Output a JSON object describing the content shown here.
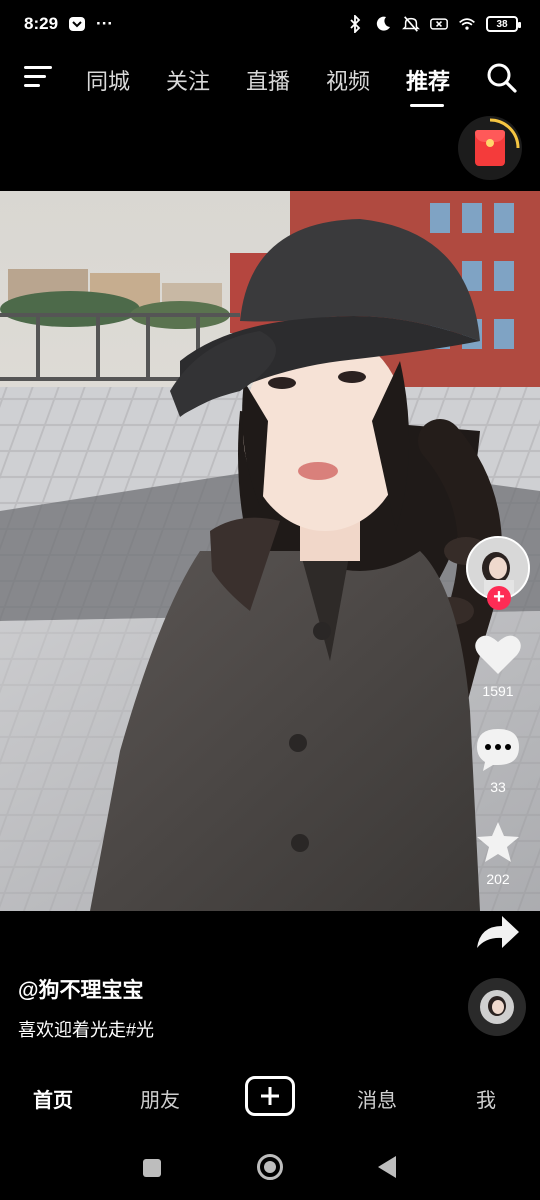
{
  "status_bar": {
    "time": "8:29",
    "more": "···",
    "battery": "38"
  },
  "top_nav": {
    "tabs": [
      {
        "label": "同城"
      },
      {
        "label": "关注"
      },
      {
        "label": "直播"
      },
      {
        "label": "视频"
      },
      {
        "label": "推荐"
      }
    ],
    "active_tab": "推荐"
  },
  "actions": {
    "likes": "1591",
    "comments": "33",
    "favorites": "202"
  },
  "post": {
    "author": "@狗不理宝宝",
    "description": "喜欢迎着光走#光"
  },
  "bottom_nav": {
    "home": "首页",
    "friends": "朋友",
    "messages": "消息",
    "me": "我"
  },
  "icons": {
    "menu": "menu-icon",
    "search": "search-icon",
    "heart": "heart-icon",
    "comment": "comment-icon",
    "star": "star-icon",
    "share": "share-icon",
    "plus": "plus-icon"
  },
  "colors": {
    "accent": "#fe2c55",
    "background": "#000000"
  }
}
